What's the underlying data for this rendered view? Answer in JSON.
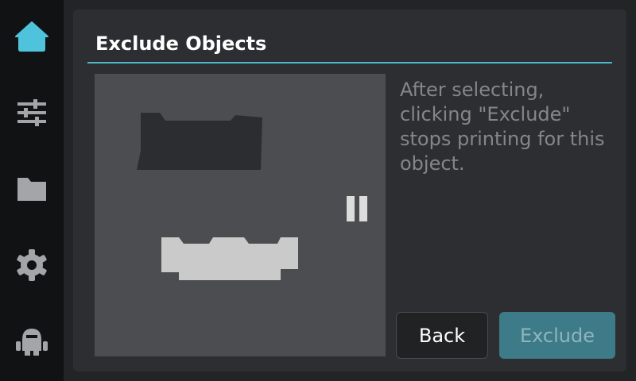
{
  "sidebar": {
    "items": [
      {
        "name": "home",
        "icon": "home-icon",
        "active": true
      },
      {
        "name": "tune",
        "icon": "sliders-icon",
        "active": false
      },
      {
        "name": "files",
        "icon": "folder-icon",
        "active": false
      },
      {
        "name": "settings",
        "icon": "gear-icon",
        "active": false
      },
      {
        "name": "robot",
        "icon": "robot-icon",
        "active": false
      }
    ],
    "active_color": "#4fc3dc",
    "inactive_color": "#a4a5a9"
  },
  "dialog": {
    "title": "Exclude Objects",
    "description": "After selecting, clicking \"Exclude\" stops printing for this object.",
    "back_label": "Back",
    "exclude_label": "Exclude",
    "accent_color": "#4fb7c9"
  },
  "preview": {
    "objects": [
      {
        "name": "object-1",
        "state": "unselected"
      },
      {
        "name": "object-2",
        "state": "printing"
      }
    ],
    "status_icon": "pause-icon"
  }
}
